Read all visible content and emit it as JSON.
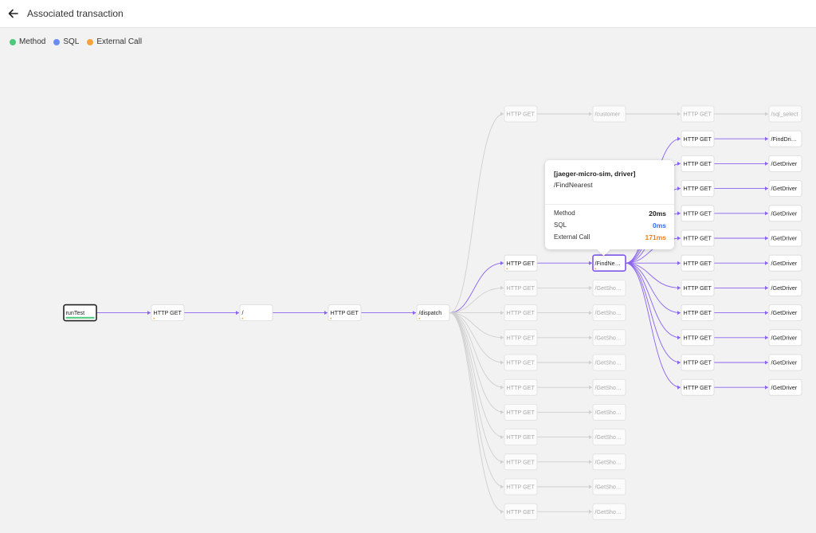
{
  "header": {
    "title": "Associated transaction"
  },
  "legend": {
    "method": {
      "label": "Method",
      "color": "#4cc97a"
    },
    "sql": {
      "label": "SQL",
      "color": "#6c8cf5"
    },
    "external": {
      "label": "External Call",
      "color": "#f5a33c"
    }
  },
  "graph": {
    "nodes": [
      {
        "id": "runTest",
        "label": "runTest",
        "state": "root",
        "col": 0,
        "row": 8
      },
      {
        "id": "get1",
        "label": "HTTP GET",
        "state": "active",
        "col": 1,
        "row": 8,
        "marker": "#f5a33c"
      },
      {
        "id": "slash",
        "label": "/",
        "state": "active",
        "col": 2,
        "row": 8,
        "marker": "#f5a33c"
      },
      {
        "id": "get2",
        "label": "HTTP GET",
        "state": "active",
        "col": 3,
        "row": 8,
        "marker": "#f5a33c"
      },
      {
        "id": "dispatch",
        "label": "/dispatch",
        "state": "active",
        "col": 4,
        "row": 8,
        "marker": "#f5a33c"
      },
      {
        "id": "c5r0",
        "label": "HTTP GET",
        "state": "faded",
        "col": 5,
        "row": 0
      },
      {
        "id": "c5r6",
        "label": "HTTP GET",
        "state": "active",
        "col": 5,
        "row": 6,
        "marker": "#f5a33c"
      },
      {
        "id": "c5r7",
        "label": "HTTP GET",
        "state": "faded",
        "col": 5,
        "row": 7
      },
      {
        "id": "c5r8",
        "label": "HTTP GET",
        "state": "faded",
        "col": 5,
        "row": 8
      },
      {
        "id": "c5r9",
        "label": "HTTP GET",
        "state": "faded",
        "col": 5,
        "row": 9
      },
      {
        "id": "c5r10",
        "label": "HTTP GET",
        "state": "faded",
        "col": 5,
        "row": 10
      },
      {
        "id": "c5r11",
        "label": "HTTP GET",
        "state": "faded",
        "col": 5,
        "row": 11
      },
      {
        "id": "c5r12",
        "label": "HTTP GET",
        "state": "faded",
        "col": 5,
        "row": 12
      },
      {
        "id": "c5r13",
        "label": "HTTP GET",
        "state": "faded",
        "col": 5,
        "row": 13
      },
      {
        "id": "c5r14",
        "label": "HTTP GET",
        "state": "faded",
        "col": 5,
        "row": 14
      },
      {
        "id": "c5r15",
        "label": "HTTP GET",
        "state": "faded",
        "col": 5,
        "row": 15
      },
      {
        "id": "c5r16",
        "label": "HTTP GET",
        "state": "faded",
        "col": 5,
        "row": 16
      },
      {
        "id": "customer",
        "label": "/customer",
        "state": "faded",
        "col": 6,
        "row": 0
      },
      {
        "id": "findNearest",
        "label": "/FindNe…",
        "state": "selected",
        "col": 6,
        "row": 6,
        "marker": "#f5a33c"
      },
      {
        "id": "c6r7",
        "label": "/GetSho…",
        "state": "faded",
        "col": 6,
        "row": 7
      },
      {
        "id": "c6r8",
        "label": "/GetSho…",
        "state": "faded",
        "col": 6,
        "row": 8
      },
      {
        "id": "c6r9",
        "label": "/GetSho…",
        "state": "faded",
        "col": 6,
        "row": 9
      },
      {
        "id": "c6r10",
        "label": "/GetSho…",
        "state": "faded",
        "col": 6,
        "row": 10
      },
      {
        "id": "c6r11",
        "label": "/GetSho…",
        "state": "faded",
        "col": 6,
        "row": 11
      },
      {
        "id": "c6r12",
        "label": "/GetSho…",
        "state": "faded",
        "col": 6,
        "row": 12
      },
      {
        "id": "c6r13",
        "label": "/GetSho…",
        "state": "faded",
        "col": 6,
        "row": 13
      },
      {
        "id": "c6r14",
        "label": "/GetSho…",
        "state": "faded",
        "col": 6,
        "row": 14
      },
      {
        "id": "c6r15",
        "label": "/GetSho…",
        "state": "faded",
        "col": 6,
        "row": 15
      },
      {
        "id": "c6r16",
        "label": "/GetSho…",
        "state": "faded",
        "col": 6,
        "row": 16
      },
      {
        "id": "c7r0",
        "label": "HTTP GET",
        "state": "faded",
        "col": 7,
        "row": 0
      },
      {
        "id": "c7r1",
        "label": "HTTP GET",
        "state": "active",
        "col": 7,
        "row": 1
      },
      {
        "id": "c7r2",
        "label": "HTTP GET",
        "state": "active",
        "col": 7,
        "row": 2
      },
      {
        "id": "c7r3",
        "label": "HTTP GET",
        "state": "active",
        "col": 7,
        "row": 3
      },
      {
        "id": "c7r4",
        "label": "HTTP GET",
        "state": "active",
        "col": 7,
        "row": 4
      },
      {
        "id": "c7r5",
        "label": "HTTP GET",
        "state": "active",
        "col": 7,
        "row": 5
      },
      {
        "id": "c7r6",
        "label": "HTTP GET",
        "state": "active",
        "col": 7,
        "row": 6
      },
      {
        "id": "c7r7",
        "label": "HTTP GET",
        "state": "active",
        "col": 7,
        "row": 7
      },
      {
        "id": "c7r8",
        "label": "HTTP GET",
        "state": "active",
        "col": 7,
        "row": 8
      },
      {
        "id": "c7r9",
        "label": "HTTP GET",
        "state": "active",
        "col": 7,
        "row": 9
      },
      {
        "id": "c7r10",
        "label": "HTTP GET",
        "state": "active",
        "col": 7,
        "row": 10
      },
      {
        "id": "c7r11",
        "label": "HTTP GET",
        "state": "active",
        "col": 7,
        "row": 11
      },
      {
        "id": "sqlSelect",
        "label": "/sql_select",
        "state": "faded",
        "col": 8,
        "row": 0
      },
      {
        "id": "findDri",
        "label": "/FindDri…",
        "state": "active",
        "col": 8,
        "row": 1
      },
      {
        "id": "c8r2",
        "label": "/GetDriver",
        "state": "active",
        "col": 8,
        "row": 2
      },
      {
        "id": "c8r3",
        "label": "/GetDriver",
        "state": "active",
        "col": 8,
        "row": 3
      },
      {
        "id": "c8r4",
        "label": "/GetDriver",
        "state": "active",
        "col": 8,
        "row": 4
      },
      {
        "id": "c8r5",
        "label": "/GetDriver",
        "state": "active",
        "col": 8,
        "row": 5
      },
      {
        "id": "c8r6",
        "label": "/GetDriver",
        "state": "active",
        "col": 8,
        "row": 6
      },
      {
        "id": "c8r7",
        "label": "/GetDriver",
        "state": "active",
        "col": 8,
        "row": 7
      },
      {
        "id": "c8r8",
        "label": "/GetDriver",
        "state": "active",
        "col": 8,
        "row": 8
      },
      {
        "id": "c8r9",
        "label": "/GetDriver",
        "state": "active",
        "col": 8,
        "row": 9
      },
      {
        "id": "c8r10",
        "label": "/GetDriver",
        "state": "active",
        "col": 8,
        "row": 10
      },
      {
        "id": "c8r11",
        "label": "/GetDriver",
        "state": "active",
        "col": 8,
        "row": 11
      }
    ],
    "edges": [
      [
        "runTest",
        "get1",
        "active"
      ],
      [
        "get1",
        "slash",
        "active"
      ],
      [
        "slash",
        "get2",
        "active"
      ],
      [
        "get2",
        "dispatch",
        "active"
      ],
      [
        "dispatch",
        "c5r0",
        "faded"
      ],
      [
        "dispatch",
        "c5r6",
        "active"
      ],
      [
        "dispatch",
        "c5r7",
        "faded"
      ],
      [
        "dispatch",
        "c5r8",
        "faded"
      ],
      [
        "dispatch",
        "c5r9",
        "faded"
      ],
      [
        "dispatch",
        "c5r10",
        "faded"
      ],
      [
        "dispatch",
        "c5r11",
        "faded"
      ],
      [
        "dispatch",
        "c5r12",
        "faded"
      ],
      [
        "dispatch",
        "c5r13",
        "faded"
      ],
      [
        "dispatch",
        "c5r14",
        "faded"
      ],
      [
        "dispatch",
        "c5r15",
        "faded"
      ],
      [
        "dispatch",
        "c5r16",
        "faded"
      ],
      [
        "c5r0",
        "customer",
        "faded"
      ],
      [
        "c5r6",
        "findNearest",
        "active"
      ],
      [
        "c5r7",
        "c6r7",
        "faded"
      ],
      [
        "c5r8",
        "c6r8",
        "faded"
      ],
      [
        "c5r9",
        "c6r9",
        "faded"
      ],
      [
        "c5r10",
        "c6r10",
        "faded"
      ],
      [
        "c5r11",
        "c6r11",
        "faded"
      ],
      [
        "c5r12",
        "c6r12",
        "faded"
      ],
      [
        "c5r13",
        "c6r13",
        "faded"
      ],
      [
        "c5r14",
        "c6r14",
        "faded"
      ],
      [
        "c5r15",
        "c6r15",
        "faded"
      ],
      [
        "c5r16",
        "c6r16",
        "faded"
      ],
      [
        "customer",
        "c7r0",
        "faded"
      ],
      [
        "findNearest",
        "c7r1",
        "active"
      ],
      [
        "findNearest",
        "c7r2",
        "active"
      ],
      [
        "findNearest",
        "c7r3",
        "active"
      ],
      [
        "findNearest",
        "c7r4",
        "active"
      ],
      [
        "findNearest",
        "c7r5",
        "active"
      ],
      [
        "findNearest",
        "c7r6",
        "active"
      ],
      [
        "findNearest",
        "c7r7",
        "active"
      ],
      [
        "findNearest",
        "c7r8",
        "active"
      ],
      [
        "findNearest",
        "c7r9",
        "active"
      ],
      [
        "findNearest",
        "c7r10",
        "active"
      ],
      [
        "findNearest",
        "c7r11",
        "active"
      ],
      [
        "c7r0",
        "sqlSelect",
        "faded"
      ],
      [
        "c7r1",
        "findDri",
        "active"
      ],
      [
        "c7r2",
        "c8r2",
        "active"
      ],
      [
        "c7r3",
        "c8r3",
        "active"
      ],
      [
        "c7r4",
        "c8r4",
        "active"
      ],
      [
        "c7r5",
        "c8r5",
        "active"
      ],
      [
        "c7r6",
        "c8r6",
        "active"
      ],
      [
        "c7r7",
        "c8r7",
        "active"
      ],
      [
        "c7r8",
        "c8r8",
        "active"
      ],
      [
        "c7r9",
        "c8r9",
        "active"
      ],
      [
        "c7r10",
        "c8r10",
        "active"
      ],
      [
        "c7r11",
        "c8r11",
        "active"
      ]
    ],
    "colors": {
      "active_edge": "#8a63f0",
      "faded_edge": "#cfcfcf",
      "selected_border": "#7d57e8",
      "root_border": "#222222",
      "root_bar": "#4cc97a"
    }
  },
  "tooltip": {
    "service": "[jaeger-micro-sim, driver]",
    "operation": "/FindNearest",
    "rows": [
      {
        "label": "Method",
        "value": "20ms",
        "color": "#222222"
      },
      {
        "label": "SQL",
        "value": "0ms",
        "color": "#3a6df0"
      },
      {
        "label": "External Call",
        "value": "171ms",
        "color": "#f07d1a"
      }
    ]
  }
}
